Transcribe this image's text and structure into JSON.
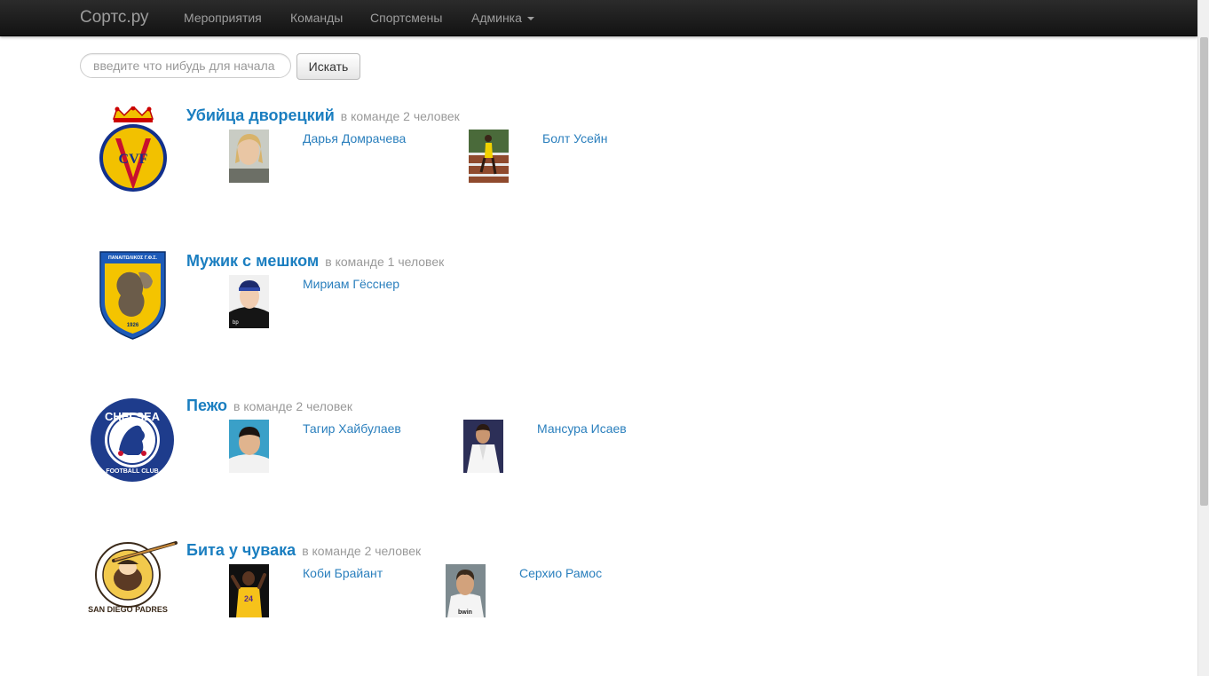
{
  "navbar": {
    "brand": "Сортс.ру",
    "items": [
      {
        "label": "Мероприятия"
      },
      {
        "label": "Команды"
      },
      {
        "label": "Спортсмены"
      },
      {
        "label": "Админка"
      }
    ]
  },
  "search": {
    "placeholder": "введите что нибудь для начала",
    "value": "",
    "button_label": "Искать"
  },
  "teams": [
    {
      "name": "Убийца дворецкий",
      "count": "в команде 2 человек",
      "logo_icon": "villarreal-crest-icon",
      "players": [
        {
          "name": "Дарья Домрачева"
        },
        {
          "name": "Болт Усейн"
        }
      ]
    },
    {
      "name": "Мужик с мешком",
      "count": "в команде 1 человек",
      "logo_icon": "panaitolikos-crest-icon",
      "logo_text": "ΠΑΝΑΙΤΩΛΙΚΟΣ Γ.Φ.Σ.",
      "logo_year": "1926",
      "players": [
        {
          "name": "Мириам Гёсснер"
        }
      ]
    },
    {
      "name": "Пежо",
      "count": "в команде 2 человек",
      "logo_icon": "chelsea-crest-icon",
      "logo_text_top": "CHELSEA",
      "logo_text_bottom": "FOOTBALL CLUB",
      "players": [
        {
          "name": "Тагир Хайбулаев"
        },
        {
          "name": "Мансура Исаев"
        }
      ]
    },
    {
      "name": "Бита у чувака",
      "count": "в команде 2 человек",
      "logo_icon": "san-diego-padres-logo-icon",
      "logo_text": "SAN DIEGO PADRES",
      "players": [
        {
          "name": "Коби Брайант"
        },
        {
          "name": "Серхио Рамос"
        }
      ]
    }
  ]
}
